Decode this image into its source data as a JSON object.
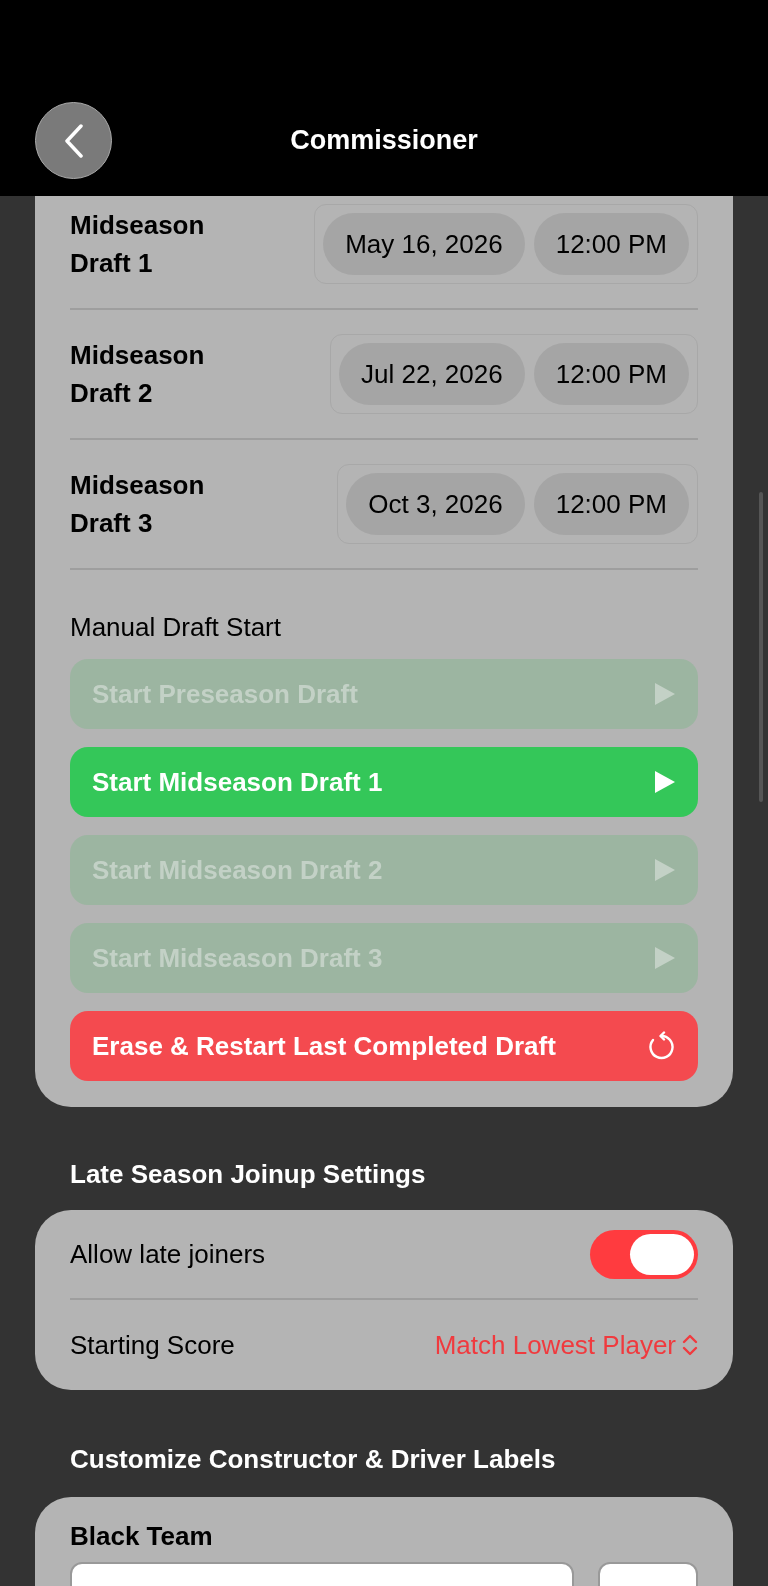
{
  "nav": {
    "title": "Commissioner"
  },
  "drafts": [
    {
      "label": "Midseason Draft 1",
      "date": "May 16, 2026",
      "time": "12:00 PM"
    },
    {
      "label": "Midseason Draft 2",
      "date": "Jul 22, 2026",
      "time": "12:00 PM"
    },
    {
      "label": "Midseason Draft 3",
      "date": "Oct 3, 2026",
      "time": "12:00 PM"
    }
  ],
  "manual_start": {
    "title": "Manual Draft Start",
    "buttons": [
      {
        "kind": "start",
        "label": "Start Preseason Draft",
        "disabled": true
      },
      {
        "kind": "start",
        "label": "Start Midseason Draft 1",
        "disabled": false
      },
      {
        "kind": "start",
        "label": "Start Midseason Draft 2",
        "disabled": true
      },
      {
        "kind": "start",
        "label": "Start Midseason Draft 3",
        "disabled": true
      },
      {
        "kind": "erase",
        "label": "Erase & Restart Last Completed Draft",
        "disabled": false
      }
    ]
  },
  "late_season": {
    "title": "Late Season Joinup Settings",
    "allow_label": "Allow late joiners",
    "allow_on": true,
    "score_label": "Starting Score",
    "score_value": "Match Lowest Player"
  },
  "labels": {
    "title": "Customize Constructor & Driver Labels",
    "team": "Black Team"
  }
}
